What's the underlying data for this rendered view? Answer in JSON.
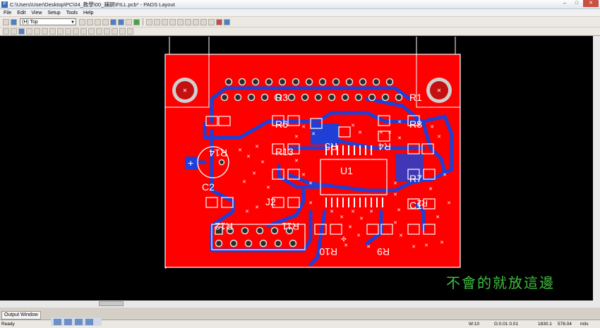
{
  "window": {
    "title": "C:\\Users\\User\\Desktop\\PC\\04_教學\\00_鋪銅\\FILL.pcb* - PADS Layout",
    "app_icon": "pads-layout-icon",
    "controls": [
      "minimize",
      "maximize",
      "close"
    ]
  },
  "menu": [
    "File",
    "Edit",
    "View",
    "Setup",
    "Tools",
    "Help"
  ],
  "toolbar": {
    "layer_select": "(H) Top"
  },
  "board": {
    "colors": {
      "background": "#000000",
      "copper_pour": "#ff0000",
      "traces": "#1f3fd6",
      "silkscreen": "#ffffff",
      "pads": "#c0c0c0"
    },
    "labels": [
      {
        "id": "R3",
        "text": "R3"
      },
      {
        "id": "R1",
        "text": "R1"
      },
      {
        "id": "R6",
        "text": "R6"
      },
      {
        "id": "R8",
        "text": "R8"
      },
      {
        "id": "R14",
        "text": "R14"
      },
      {
        "id": "R13",
        "text": "R13"
      },
      {
        "id": "R5",
        "text": "R5"
      },
      {
        "id": "R4",
        "text": "R4"
      },
      {
        "id": "U1",
        "text": "U1"
      },
      {
        "id": "C2",
        "text": "C2"
      },
      {
        "id": "R7",
        "text": "R7"
      },
      {
        "id": "J2",
        "text": "J2"
      },
      {
        "id": "C1",
        "text": "C1"
      },
      {
        "id": "R2",
        "text": "R2"
      },
      {
        "id": "R12",
        "text": "R12"
      },
      {
        "id": "R11",
        "text": "R11"
      },
      {
        "id": "R10",
        "text": "R10"
      },
      {
        "id": "R9",
        "text": "R9"
      }
    ],
    "plus_marker": "+",
    "caption": "不會的就放這邊"
  },
  "output_window_tab": "Output Window",
  "status": {
    "ready": "Ready",
    "width": "W:10",
    "grid": "G:0.01 0.01",
    "x": "1830.1",
    "y": "578.04",
    "units": "mils"
  }
}
